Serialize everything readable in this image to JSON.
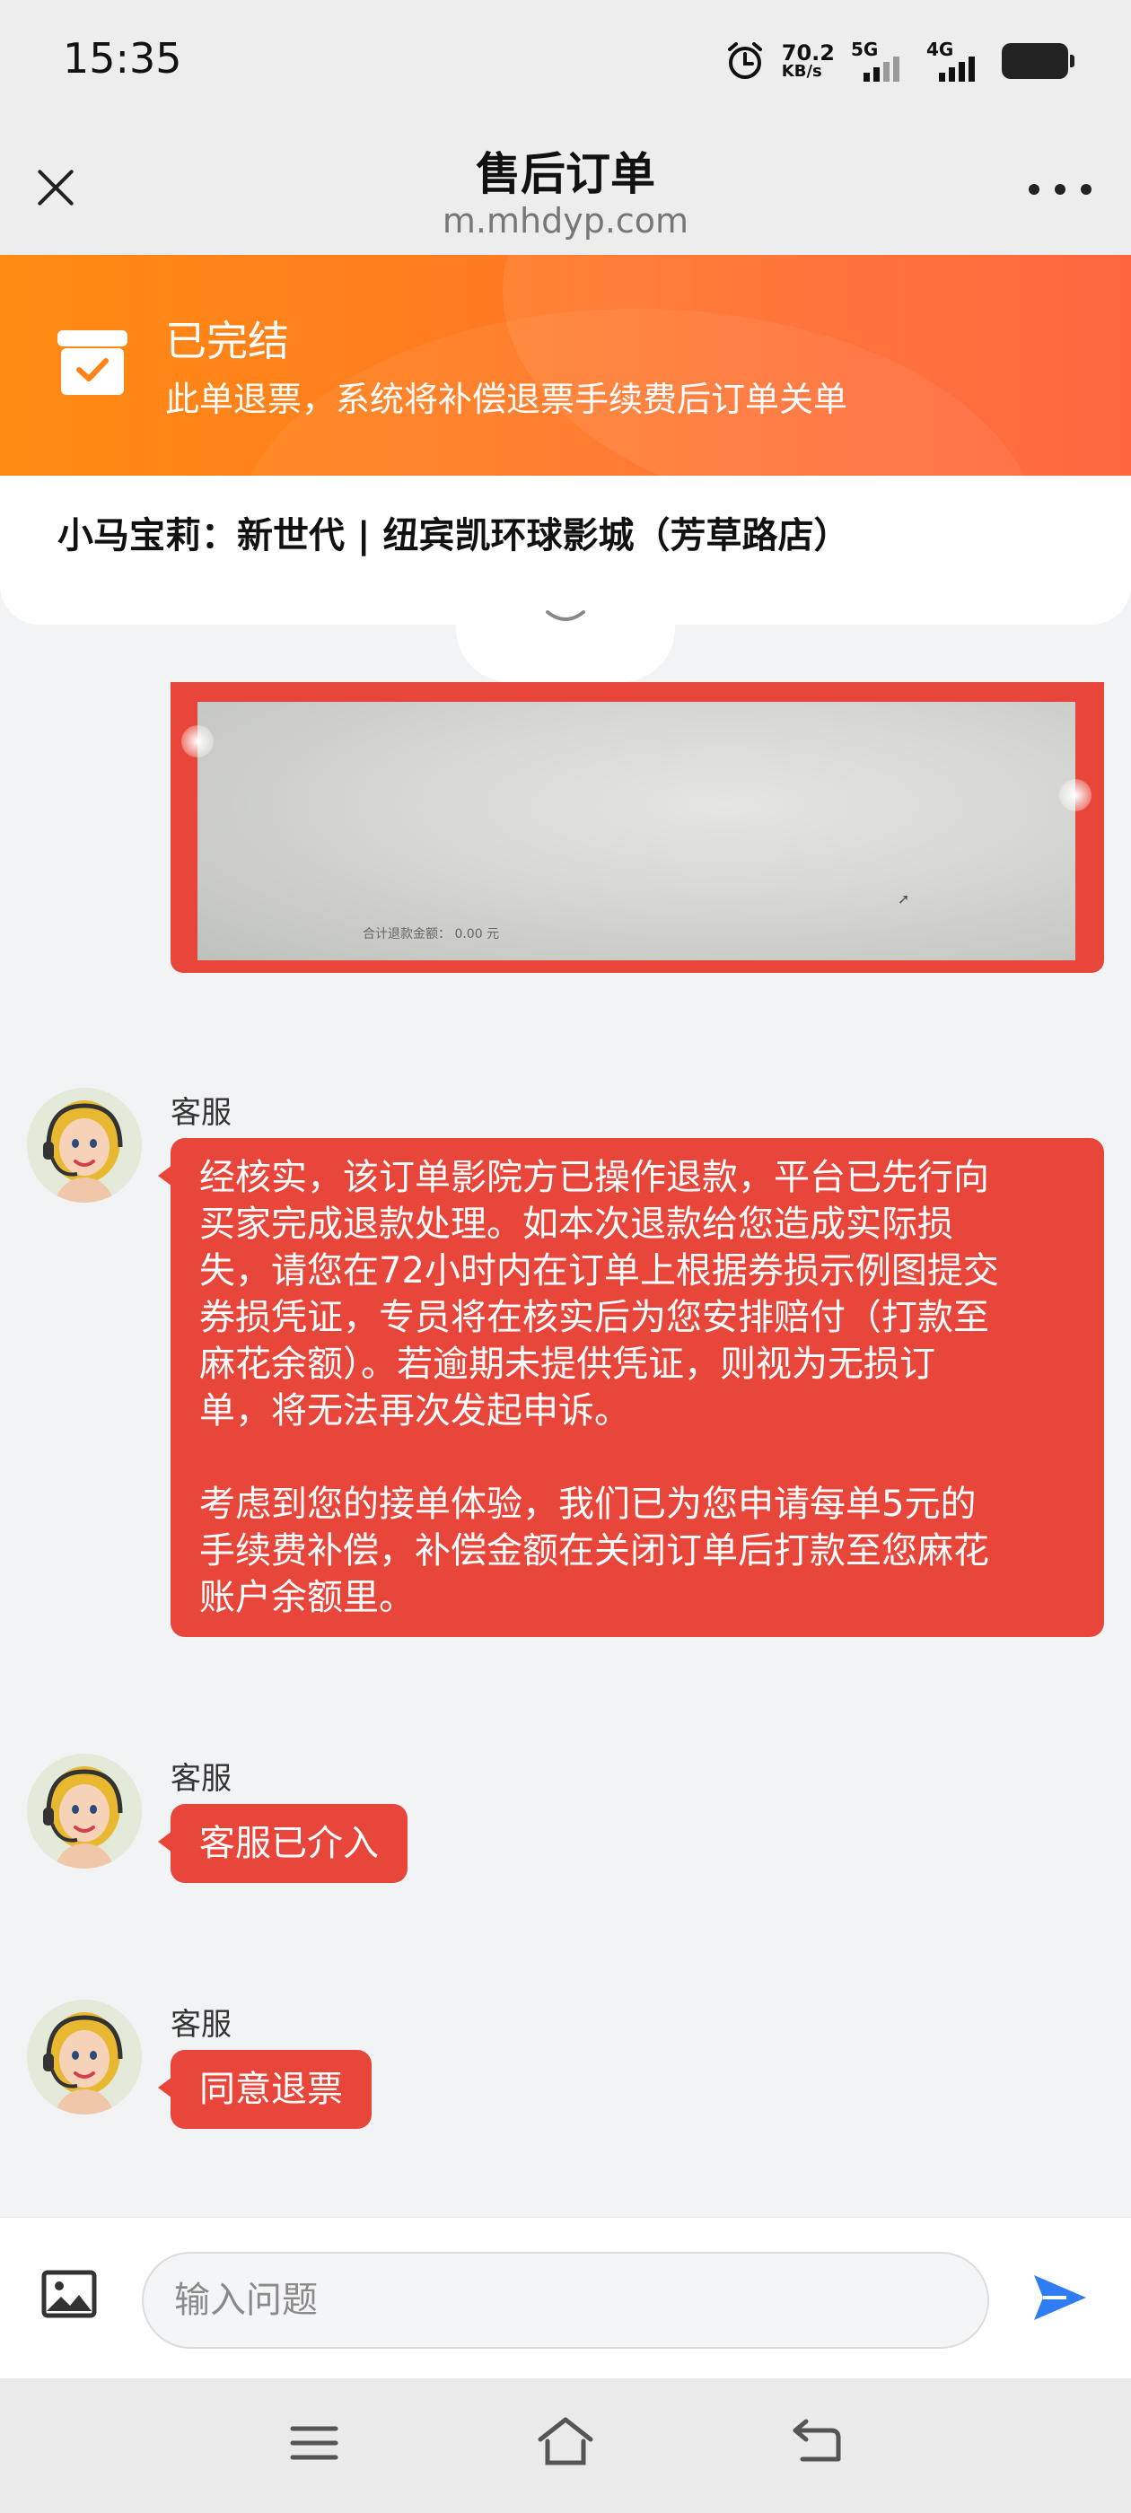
{
  "status_bar": {
    "time": "15:35",
    "speed_value": "70.2",
    "speed_unit": "KB/s",
    "net1": "5G",
    "net2": "4G"
  },
  "header": {
    "title": "售后订单",
    "url": "m.mhdyp.com"
  },
  "order_status": {
    "title": "已完结",
    "description": "此单退票，系统将补偿退票手续费后订单关单"
  },
  "cinema": {
    "name": "小马宝莉：新世代 | 纽宾凯环球影城（芳草路店）"
  },
  "chat": {
    "image_caption": "合计退款金额： 0.00 元",
    "messages": [
      {
        "sender": "客服",
        "paragraphs": [
          "经核实，该订单影院方已操作退款，平台已先行向\n买家完成退款处理。如本次退款给您造成实际损\n失，请您在72小时内在订单上根据券损示例图提交\n券损凭证，专员将在核实后为您安排赔付（打款至\n麻花余额）。若逾期未提供凭证，则视为无损订\n单，将无法再次发起申诉。",
          "考虑到您的接单体验，我们已为您申请每单5元的\n手续费补偿，补偿金额在关闭订单后打款至您麻花\n账户余额里。"
        ]
      },
      {
        "sender": "客服",
        "paragraphs": [
          "客服已介入"
        ]
      },
      {
        "sender": "客服",
        "paragraphs": [
          "同意退票"
        ]
      }
    ]
  },
  "input": {
    "placeholder": "输入问题"
  },
  "colors": {
    "accent": "#e8463a",
    "banner_start": "#ff8b12",
    "banner_end": "#ff5a2e",
    "send": "#2f7df6"
  }
}
